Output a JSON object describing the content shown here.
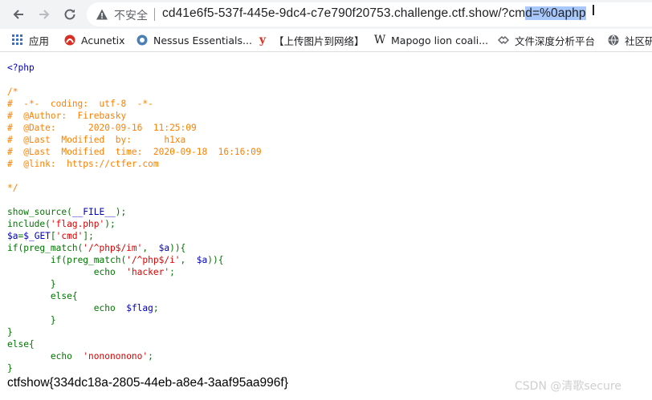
{
  "browser": {
    "not_secure_label": "不安全",
    "url_prefix": "cd41e6f5-537f-445e-9dc4-c7e790f20753.challenge.ctf.show/?cm",
    "url_selected": "d=%0aphp"
  },
  "bookmarks": [
    {
      "label": "应用",
      "icon": "apps-grid-icon"
    },
    {
      "label": "Acunetix",
      "icon": "acunetix-icon"
    },
    {
      "label": "Nessus Essentials...",
      "icon": "nessus-icon"
    },
    {
      "label": "【上传图片到网络】",
      "icon": "y-icon"
    },
    {
      "label": "Mapogo lion coali...",
      "icon": "wikipedia-w-icon"
    },
    {
      "label": "文件深度分析平台",
      "icon": "analysis-icon"
    },
    {
      "label": "社区研",
      "icon": "globe-icon"
    }
  ],
  "code": {
    "open_tag": "<?php",
    "comment_lines": [
      "/*",
      "#  -*-  coding:  utf-8  -*-",
      "#  @Author:  Firebasky",
      "#  @Date:      2020-09-16  11:25:09",
      "#  @Last  Modified  by:      h1xa",
      "#  @Last  Modified  time:  2020-09-18  16:16:09",
      "#  @link:  https://ctfer.com",
      "",
      "*/"
    ],
    "l1_fn": "show_source(",
    "l1_const": "__FILE__",
    "l1_end": ");",
    "l2_kw": "include(",
    "l2_str": "'flag.php'",
    "l2_end": ");",
    "l3_var": "$a",
    "l3_op": "=",
    "l3_var2": "$_GET",
    "l3_b1": "[",
    "l3_str": "'cmd'",
    "l3_b2": "];",
    "l4_kw": "if(preg_match(",
    "l4_str": "'/^php$/im'",
    "l4_sep": ",  ",
    "l4_var": "$a",
    "l4_end": ")){",
    "l5_indent": "        ",
    "l5_kw": "if(preg_match(",
    "l5_str": "'/^php$/i'",
    "l5_sep": ",  ",
    "l5_var": "$a",
    "l5_end": ")){",
    "l6_indent": "                ",
    "l6_kw": "echo  ",
    "l6_str": "'hacker'",
    "l6_end": ";",
    "l7": "        }",
    "l8": "        else{",
    "l9_indent": "                ",
    "l9_kw": "echo  ",
    "l9_var": "$flag",
    "l9_end": ";",
    "l10": "        }",
    "l11": "}",
    "l12": "else{",
    "l13_indent": "        ",
    "l13_kw": "echo  ",
    "l13_str": "'nonononono'",
    "l13_end": ";",
    "l14": "}"
  },
  "flag_output": "ctfshow{334dc18a-2805-44eb-a8e4-3aaf95aa996f}",
  "watermark": "CSDN @清歌secure",
  "colors": {
    "keyword": "#007700",
    "default": "#0000bb",
    "comment": "#ff8000",
    "string": "#dd0000"
  }
}
